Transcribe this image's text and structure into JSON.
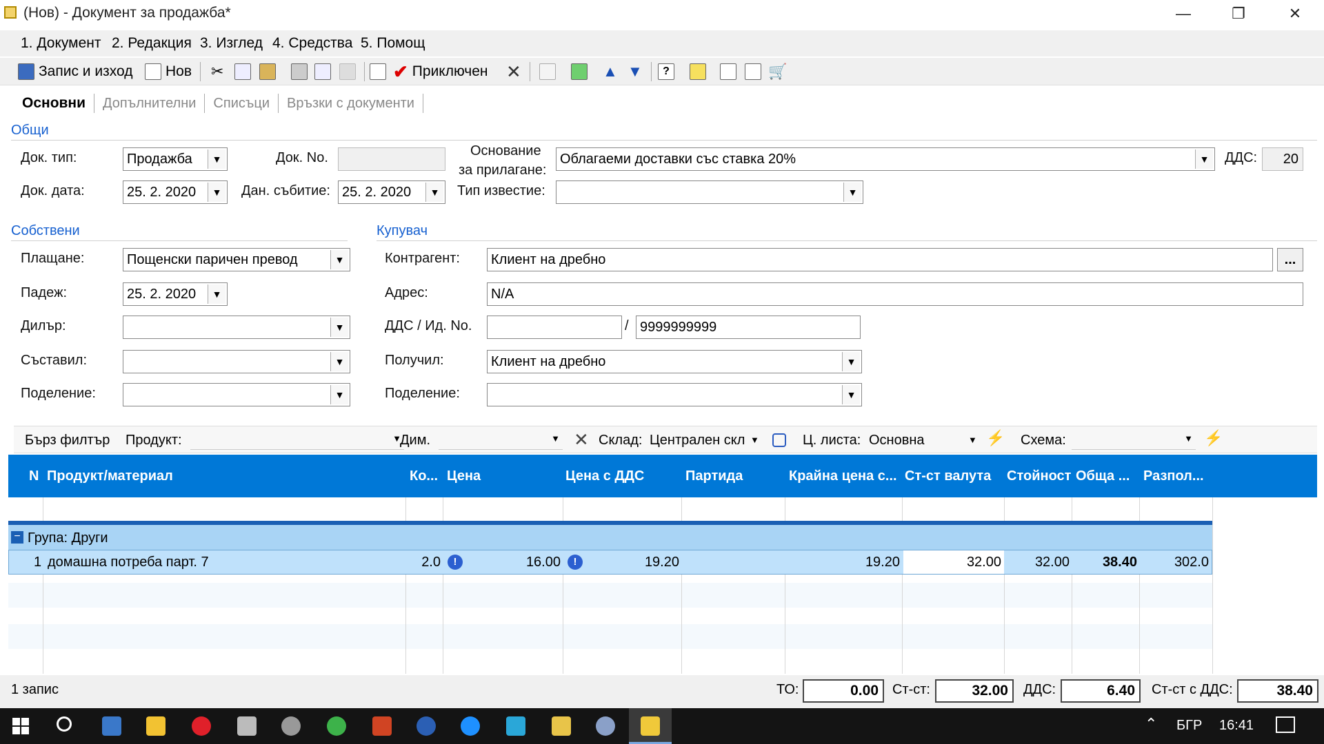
{
  "window": {
    "title": "(Нов) - Документ за продажба*",
    "minimize": "—",
    "restore": "❐",
    "close": "✕"
  },
  "menu": [
    "1. Документ",
    "2. Редакция",
    "3. Изглед",
    "4. Средства",
    "5. Помощ"
  ],
  "toolbar": {
    "save_exit": "Запис и изход",
    "new": "Нов",
    "done": "Приключен"
  },
  "tabs": [
    "Основни",
    "Допълнителни",
    "Списъци",
    "Връзки с документи"
  ],
  "general": {
    "section": "Общи",
    "doc_type_label": "Док. тип:",
    "doc_type": "Продажба",
    "doc_no_label": "Док. No.",
    "doc_no": "",
    "basis_label1": "Основание",
    "basis_label2": "за прилагане:",
    "basis": "Облагаеми доставки със ставка 20%",
    "vat_label": "ДДС:",
    "vat": "20",
    "doc_date_label": "Док. дата:",
    "doc_date": "25.  2. 2020",
    "tax_event_label": "Дан. събитие:",
    "tax_event": "25.  2. 2020",
    "notice_type_label": "Тип известие:",
    "notice_type": ""
  },
  "own": {
    "section": "Собствени",
    "payment_label": "Плащане:",
    "payment": "Пощенски паричен превод",
    "due_label": "Падеж:",
    "due": "25.  2. 2020",
    "dealer_label": "Дилър:",
    "dealer": "",
    "author_label": "Съставил:",
    "author": "",
    "division_label": "Поделение:",
    "division": ""
  },
  "buyer": {
    "section": "Купувач",
    "contractor_label": "Контрагент:",
    "contractor": "Клиент на дребно",
    "address_label": "Адрес:",
    "address": "N/A",
    "vatid_label": "ДДС / Ид. No.",
    "vat_no": "",
    "slash": "/",
    "id_no": "9999999999",
    "receiver_label": "Получил:",
    "receiver": "Клиент на дребно",
    "division_label": "Поделение:",
    "division": "",
    "more": "..."
  },
  "filter": {
    "quick": "Бърз филтър",
    "product_label": "Продукт:",
    "dim_label": "Дим.",
    "warehouse_label": "Склад:",
    "warehouse": "Централен скл",
    "pricelist_label": "Ц. листа:",
    "pricelist": "Основна",
    "scheme_label": "Схема:"
  },
  "grid": {
    "columns": [
      "N",
      "Продукт/материал",
      "Ко...",
      "Цена",
      "Цена с ДДС",
      "Партида",
      "Крайна цена с...",
      "Ст-ст валута",
      "Стойност",
      "Обща ...",
      "Разпол..."
    ],
    "group": "Група: Други",
    "rows": [
      {
        "n": "1",
        "product": "домашна потреба парт. 7",
        "qty": "2.0",
        "price": "16.00",
        "price_vat": "19.20",
        "batch": "",
        "final_price": "19.20",
        "value_currency": "32.00",
        "value": "32.00",
        "total": "38.40",
        "available": "302.0"
      }
    ]
  },
  "footer": {
    "records": "1 запис",
    "to_label": "ТО:",
    "to": "0.00",
    "value_label": "Ст-ст:",
    "value": "32.00",
    "vat_label": "ДДС:",
    "vat": "6.40",
    "value_vat_label": "Ст-ст с ДДС:",
    "value_vat": "38.40"
  },
  "taskbar": {
    "lang": "БГР",
    "time": "16:41"
  }
}
